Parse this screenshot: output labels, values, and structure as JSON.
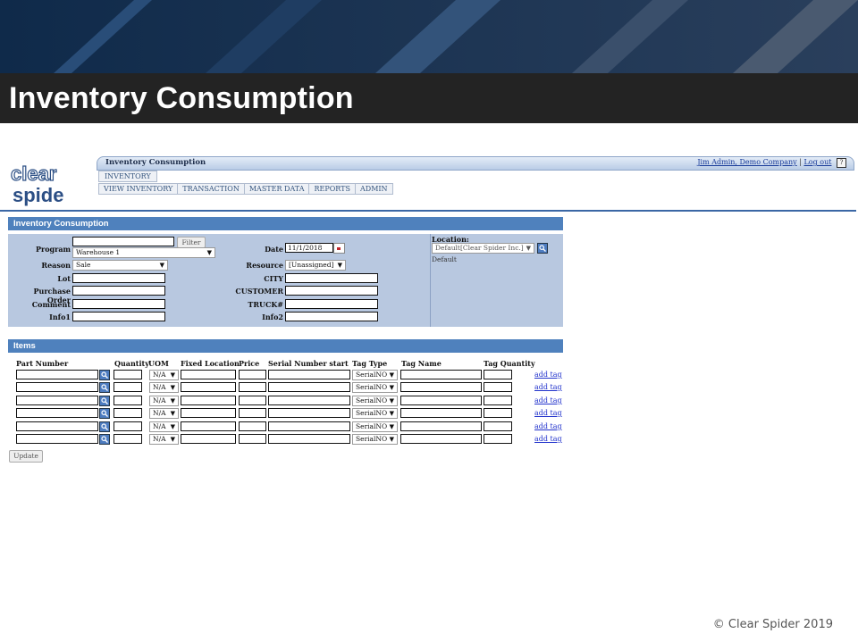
{
  "slide": {
    "title": "Inventory Consumption",
    "footer": "© Clear Spider 2019"
  },
  "logo": {
    "line1": "clear",
    "line2": "spider"
  },
  "app": {
    "menu_title": "Inventory Consumption",
    "user": {
      "name": "Jim Admin, Demo Company",
      "separator": "|",
      "logout": "Log out",
      "help": "?"
    },
    "top_tab": "INVENTORY",
    "nav_tabs": [
      "VIEW INVENTORY",
      "TRANSACTION",
      "MASTER DATA",
      "REPORTS",
      "ADMIN"
    ]
  },
  "form": {
    "header": "Inventory Consumption",
    "program_label": "Program",
    "program_filter_value": "",
    "filter_button": "Filter",
    "program_select": "Warehouse 1",
    "reason_label": "Reason",
    "reason_select": "Sale",
    "lot_label": "Lot",
    "po_label": "Purchase Order",
    "comment_label": "Comment",
    "info1_label": "Info1",
    "date_label": "Date",
    "date_value": "11/1/2018",
    "resource_label": "Resource",
    "resource_select": "[Unassigned]",
    "city_label": "CITY",
    "customer_label": "CUSTOMER",
    "truck_label": "TRUCK#",
    "info2_label": "Info2",
    "location_label": "Location:",
    "location_select": "Default[Clear Spider Inc.]",
    "location_text": "Default"
  },
  "items": {
    "header": "Items",
    "columns": [
      "Part Number",
      "Quantity",
      "UOM",
      "Fixed Location",
      "Price",
      "Serial Number start",
      "Tag Type",
      "Tag Name",
      "Tag Quantity"
    ],
    "rows": [
      {
        "uom": "N/A",
        "tag_type": "SerialNO",
        "add_tag": "add tag"
      },
      {
        "uom": "N/A",
        "tag_type": "SerialNO",
        "add_tag": "add tag"
      },
      {
        "uom": "N/A",
        "tag_type": "SerialNO",
        "add_tag": "add tag"
      },
      {
        "uom": "N/A",
        "tag_type": "SerialNO",
        "add_tag": "add tag"
      },
      {
        "uom": "N/A",
        "tag_type": "SerialNO",
        "add_tag": "add tag"
      },
      {
        "uom": "N/A",
        "tag_type": "SerialNO",
        "add_tag": "add tag"
      }
    ],
    "update_button": "Update"
  },
  "colors": {
    "banner": "#173454",
    "title_bar": "#232323",
    "panel_header": "#4f81bd",
    "panel_body": "#b8c8e0",
    "link": "#2233cc"
  }
}
